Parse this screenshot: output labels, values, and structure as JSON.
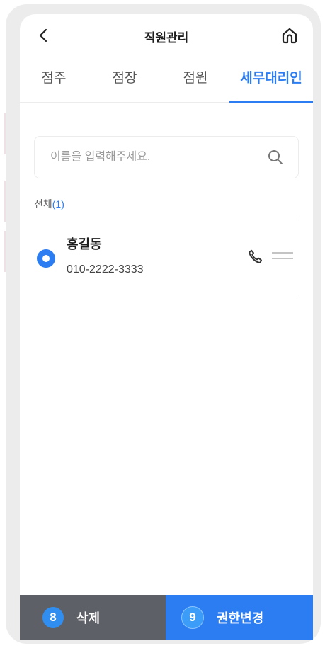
{
  "header": {
    "title": "직원관리"
  },
  "tabs": [
    {
      "label": "점주"
    },
    {
      "label": "점장"
    },
    {
      "label": "점원"
    },
    {
      "label": "세무대리인",
      "active": true
    }
  ],
  "search": {
    "placeholder": "이름을 입력해주세요."
  },
  "list": {
    "total_label": "전체",
    "total_count": "(1)",
    "items": [
      {
        "name": "홍길동",
        "phone": "010-2222-3333",
        "selected": true
      }
    ]
  },
  "actions": {
    "delete_badge": "8",
    "delete_label": "삭제",
    "permission_badge": "9",
    "permission_label": "권한변경"
  },
  "colors": {
    "accent": "#2d7df2",
    "delete_bg": "#5d6067"
  },
  "icons": [
    "back-arrow-icon",
    "home-icon",
    "search-icon",
    "phone-icon",
    "drag-handle-icon"
  ]
}
